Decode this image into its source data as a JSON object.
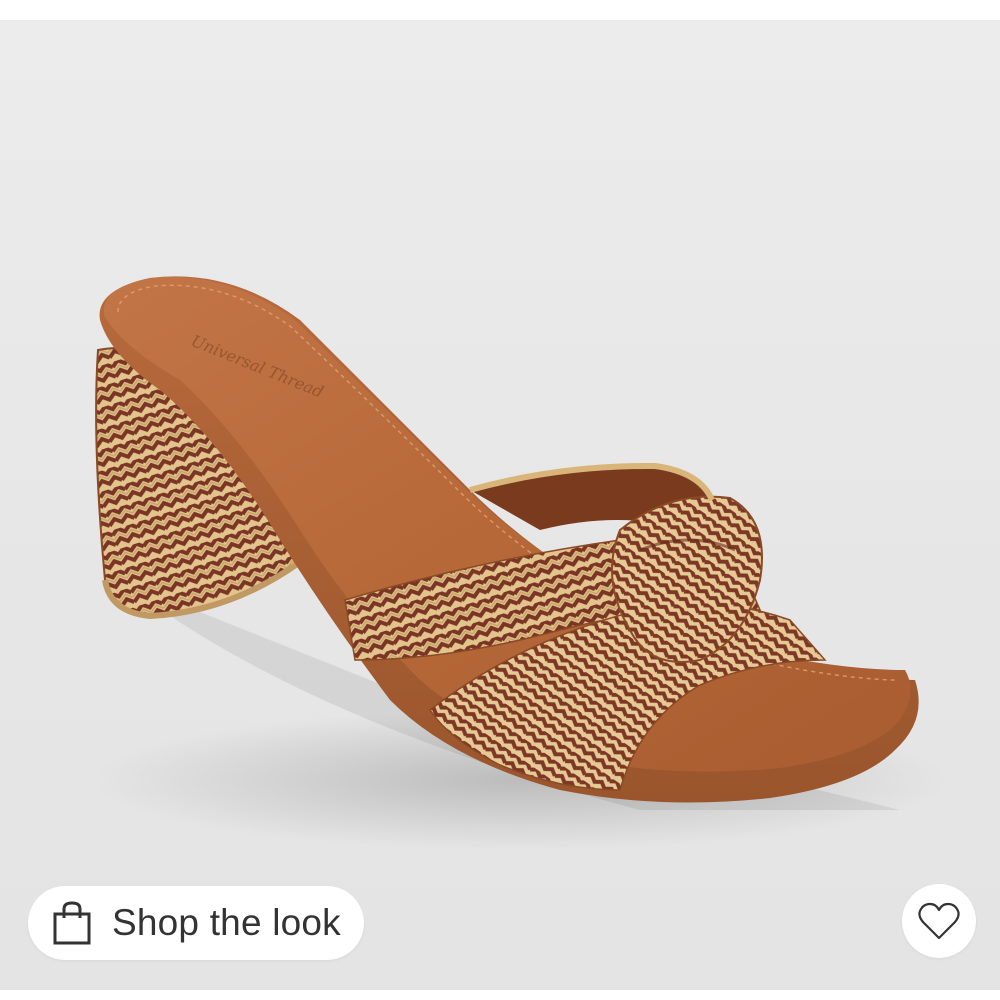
{
  "product_view": {
    "image": {
      "subject": "sandal-photo",
      "colors": {
        "background": "#e8e8e8",
        "leather": "#b86a3c",
        "leather_dark": "#8e4b26",
        "raffia_light": "#e3c48d",
        "raffia_dark": "#7a3524"
      }
    },
    "shop_the_look": {
      "label": "Shop the look",
      "icon": "shopping-bag-icon"
    },
    "favorite": {
      "icon": "heart-outline-icon"
    }
  }
}
